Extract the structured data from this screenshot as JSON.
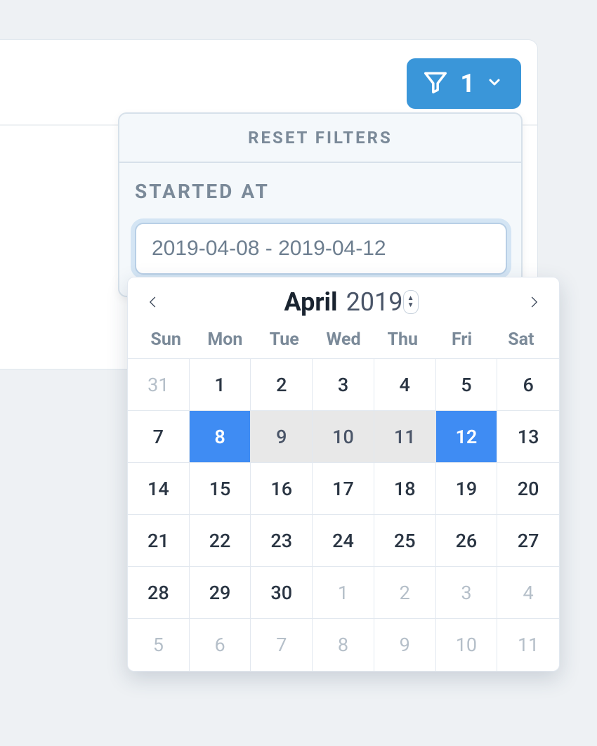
{
  "filter_button": {
    "count": "1"
  },
  "popover": {
    "reset_label": "RESET FILTERS",
    "section_label": "STARTED AT",
    "date_value": "2019-04-08 - 2019-04-12"
  },
  "calendar": {
    "month": "April",
    "year": "2019",
    "weekdays": [
      "Sun",
      "Mon",
      "Tue",
      "Wed",
      "Thu",
      "Fri",
      "Sat"
    ],
    "days": [
      {
        "n": "31",
        "class": "other"
      },
      {
        "n": "1",
        "class": ""
      },
      {
        "n": "2",
        "class": ""
      },
      {
        "n": "3",
        "class": ""
      },
      {
        "n": "4",
        "class": ""
      },
      {
        "n": "5",
        "class": ""
      },
      {
        "n": "6",
        "class": ""
      },
      {
        "n": "7",
        "class": ""
      },
      {
        "n": "8",
        "class": "selected"
      },
      {
        "n": "9",
        "class": "range"
      },
      {
        "n": "10",
        "class": "range"
      },
      {
        "n": "11",
        "class": "range"
      },
      {
        "n": "12",
        "class": "selected"
      },
      {
        "n": "13",
        "class": ""
      },
      {
        "n": "14",
        "class": ""
      },
      {
        "n": "15",
        "class": ""
      },
      {
        "n": "16",
        "class": ""
      },
      {
        "n": "17",
        "class": ""
      },
      {
        "n": "18",
        "class": ""
      },
      {
        "n": "19",
        "class": ""
      },
      {
        "n": "20",
        "class": ""
      },
      {
        "n": "21",
        "class": ""
      },
      {
        "n": "22",
        "class": ""
      },
      {
        "n": "23",
        "class": ""
      },
      {
        "n": "24",
        "class": ""
      },
      {
        "n": "25",
        "class": ""
      },
      {
        "n": "26",
        "class": ""
      },
      {
        "n": "27",
        "class": ""
      },
      {
        "n": "28",
        "class": ""
      },
      {
        "n": "29",
        "class": ""
      },
      {
        "n": "30",
        "class": ""
      },
      {
        "n": "1",
        "class": "other"
      },
      {
        "n": "2",
        "class": "other"
      },
      {
        "n": "3",
        "class": "other"
      },
      {
        "n": "4",
        "class": "other"
      },
      {
        "n": "5",
        "class": "other"
      },
      {
        "n": "6",
        "class": "other"
      },
      {
        "n": "7",
        "class": "other"
      },
      {
        "n": "8",
        "class": "other"
      },
      {
        "n": "9",
        "class": "other"
      },
      {
        "n": "10",
        "class": "other"
      },
      {
        "n": "11",
        "class": "other"
      }
    ]
  }
}
